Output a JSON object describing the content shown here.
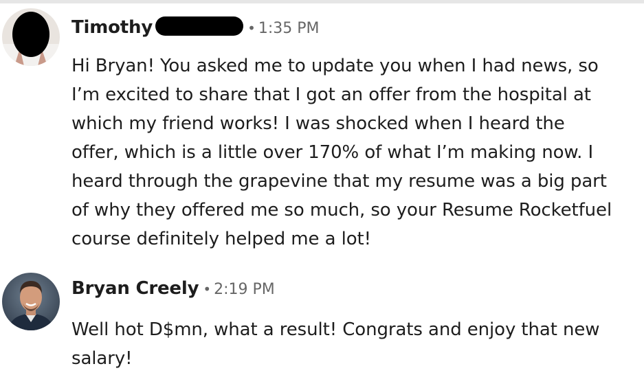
{
  "messages": [
    {
      "sender": "Timothy",
      "separator": "•",
      "time": "1:35 PM",
      "body": "Hi Bryan! You asked me to update you when I had news, so I’m excited to share that I got an offer from the hospital at which my friend works! I was shocked when I heard the offer, which is a little over 170% of what I’m making now. I heard through the grapevine that my resume was a big part of why they offered me so much, so your Resume Rocketfuel course definitely helped me a lot!"
    },
    {
      "sender": "Bryan Creely",
      "separator": "•",
      "time": "2:19 PM",
      "body": "Well hot D$mn, what a result!  Congrats and enjoy that new salary!"
    }
  ]
}
